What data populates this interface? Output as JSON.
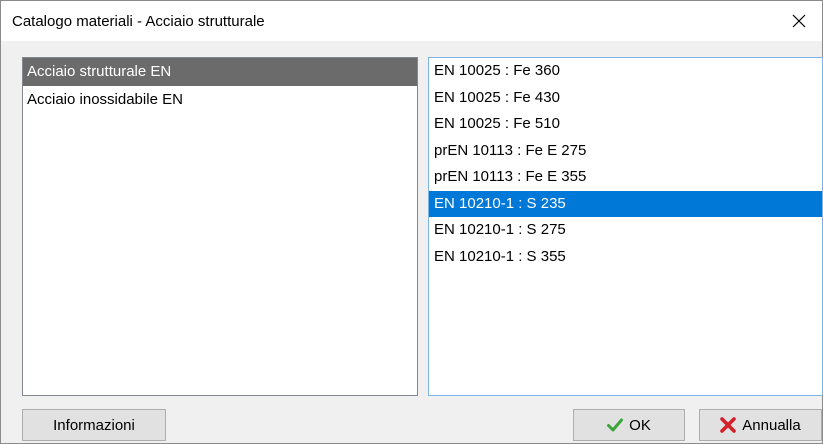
{
  "window": {
    "title": "Catalogo materiali  - Acciaio strutturale"
  },
  "categories": [
    {
      "label": "Acciaio strutturale  EN",
      "selected": true
    },
    {
      "label": "Acciaio inossidabile  EN",
      "selected": false
    }
  ],
  "materials": [
    {
      "label": "EN 10025 : Fe 360",
      "selected": false
    },
    {
      "label": "EN 10025 : Fe 430",
      "selected": false
    },
    {
      "label": "EN 10025 : Fe 510",
      "selected": false
    },
    {
      "label": "prEN 10113 : Fe E 275",
      "selected": false
    },
    {
      "label": "prEN 10113 : Fe E 355",
      "selected": false
    },
    {
      "label": "EN 10210-1 : S 235",
      "selected": true
    },
    {
      "label": "EN 10210-1 : S 275",
      "selected": false
    },
    {
      "label": "EN 10210-1 : S 355",
      "selected": false
    }
  ],
  "buttons": {
    "info_label": "Informazioni",
    "ok_label": "OK",
    "cancel_label": "Annualla"
  },
  "icons": {
    "close": "close-icon",
    "ok": "checkmark-icon",
    "cancel": "red-x-icon"
  },
  "colors": {
    "selection_blue": "#0078d7",
    "selection_gray": "#6b6b6b",
    "ok_green": "#3aa53a",
    "cancel_red": "#d4202a"
  }
}
